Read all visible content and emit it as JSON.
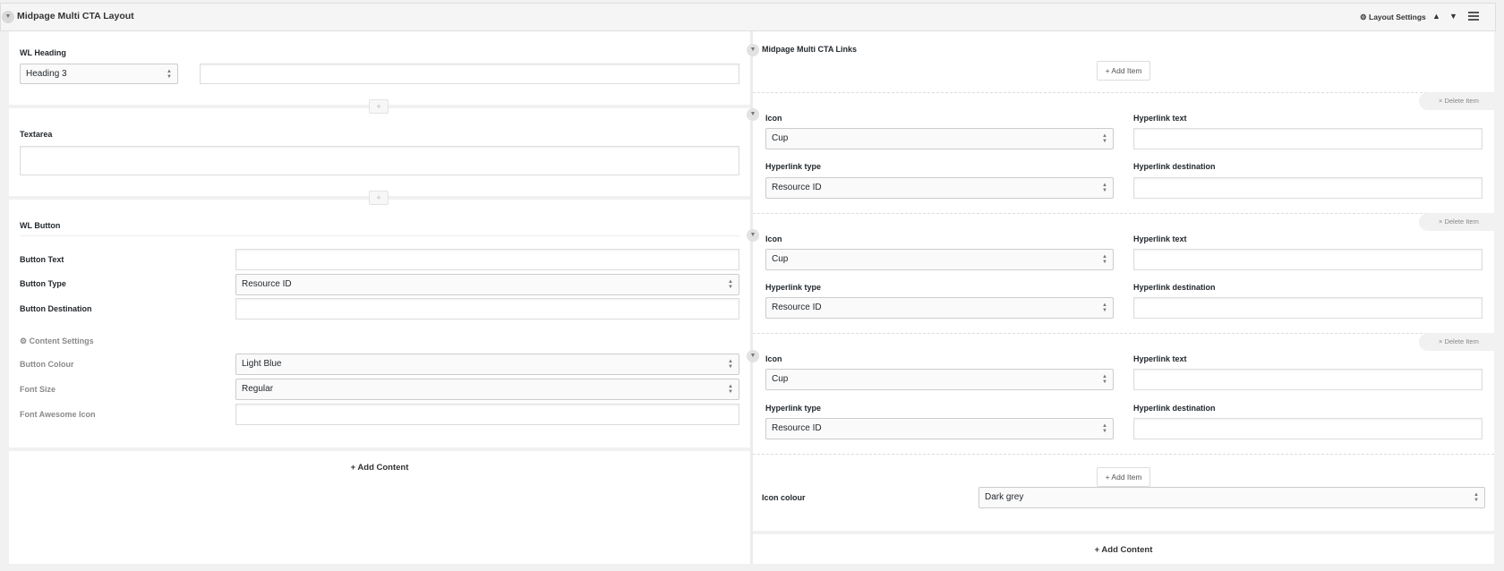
{
  "header": {
    "title": "Midpage Multi CTA Layout",
    "layout_settings": "Layout Settings",
    "up_arrow": "▲",
    "down_arrow": "▼"
  },
  "left": {
    "heading": {
      "label": "WL Heading",
      "level_value": "Heading 3",
      "text_value": ""
    },
    "textarea": {
      "label": "Textarea",
      "value": ""
    },
    "add_tab": "+",
    "button": {
      "label": "WL Button",
      "button_text_label": "Button Text",
      "button_text_value": "",
      "button_type_label": "Button Type",
      "button_type_value": "Resource ID",
      "button_dest_label": "Button Destination",
      "button_dest_value": "",
      "content_settings": "Content Settings",
      "colour_label": "Button Colour",
      "colour_value": "Light Blue",
      "font_size_label": "Font Size",
      "font_size_value": "Regular",
      "fa_icon_label": "Font Awesome Icon",
      "fa_icon_value": ""
    },
    "add_content": "+ Add Content"
  },
  "right": {
    "title": "Midpage Multi CTA Links",
    "add_item": "+ Add Item",
    "delete_item": "× Delete Item",
    "items": [
      {
        "icon_label": "Icon",
        "icon_value": "Cup",
        "text_label": "Hyperlink text",
        "text_value": "",
        "type_label": "Hyperlink type",
        "type_value": "Resource ID",
        "dest_label": "Hyperlink destination",
        "dest_value": ""
      },
      {
        "icon_label": "Icon",
        "icon_value": "Cup",
        "text_label": "Hyperlink text",
        "text_value": "",
        "type_label": "Hyperlink type",
        "type_value": "Resource ID",
        "dest_label": "Hyperlink destination",
        "dest_value": ""
      },
      {
        "icon_label": "Icon",
        "icon_value": "Cup",
        "text_label": "Hyperlink text",
        "text_value": "",
        "type_label": "Hyperlink type",
        "type_value": "Resource ID",
        "dest_label": "Hyperlink destination",
        "dest_value": ""
      }
    ],
    "icon_colour_label": "Icon colour",
    "icon_colour_value": "Dark grey",
    "add_content": "+ Add Content"
  },
  "icons": {
    "collapse": "chevron-down-icon",
    "gear": "gear-icon",
    "menu": "hamburger-menu-icon",
    "select_arrows": "select-arrows-icon"
  }
}
